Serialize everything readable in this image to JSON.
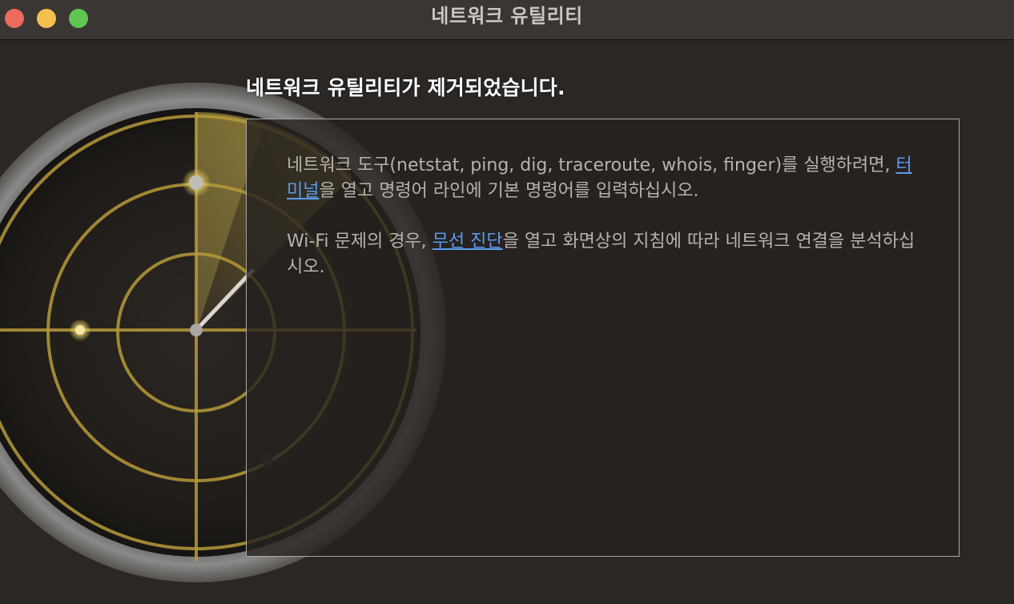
{
  "window": {
    "title": "네트워크 유틸리티"
  },
  "heading": "네트워크 유틸리티가 제거되었습니다.",
  "paragraph1": {
    "before": "네트워크 도구(netstat, ping, dig, traceroute, whois, finger)를 실행하려면, ",
    "link": "터미널",
    "after": "을 열고 명령어 라인에 기본 명령어를 입력하십시오."
  },
  "paragraph2": {
    "before": "Wi-Fi 문제의 경우, ",
    "link": "무선 진단",
    "after": "을 열고 화면상의 지침에 따라 네트워크 연결을 분석하십시오."
  },
  "colors": {
    "close": "#ed6a5e",
    "minimize": "#f5bf4f",
    "zoom": "#61c554",
    "link": "#5b9bf0",
    "radar_accent": "#c9b04a"
  },
  "icons": {
    "radar": "network-utility-radar-icon"
  }
}
